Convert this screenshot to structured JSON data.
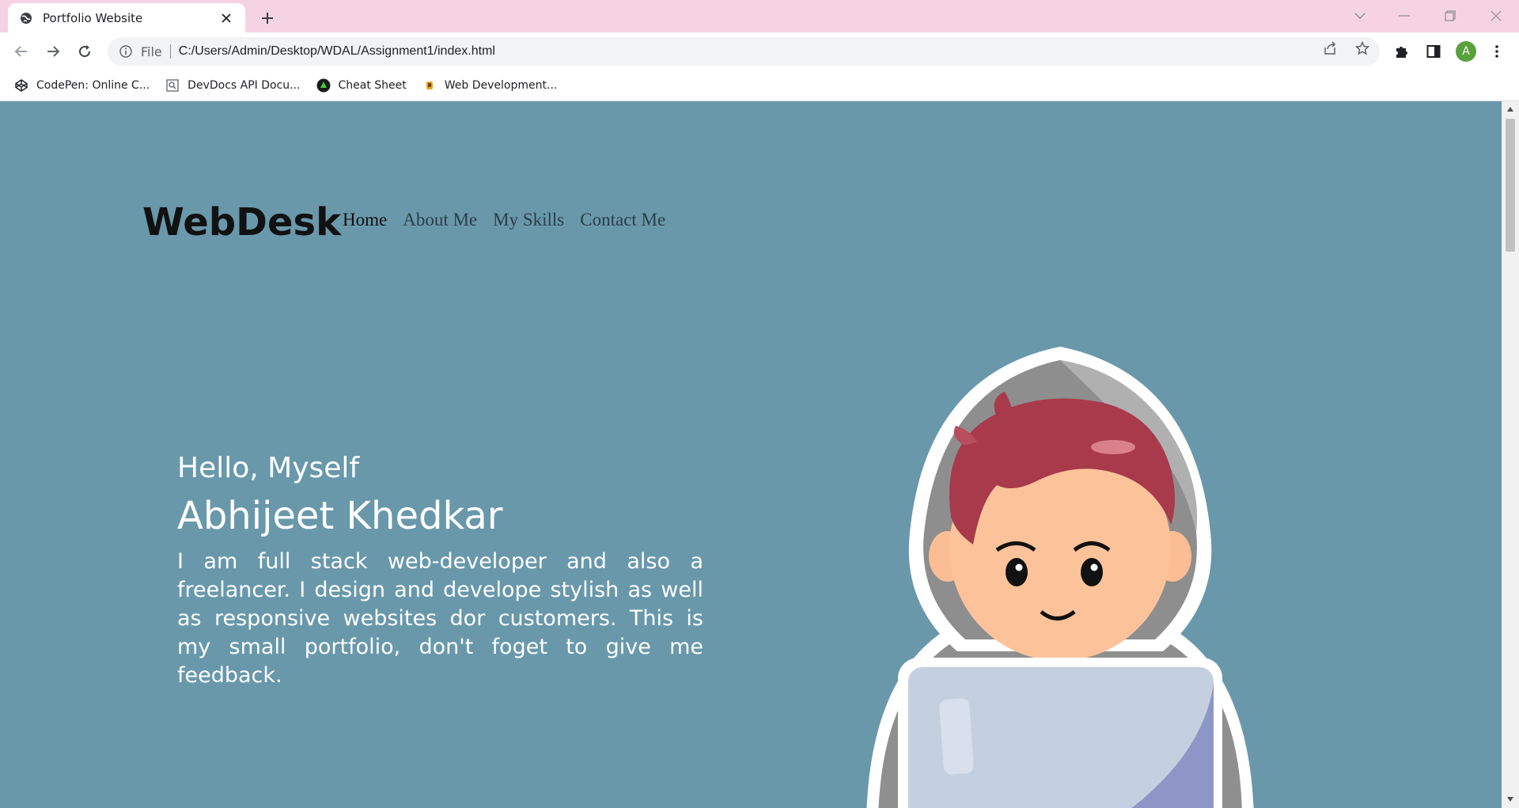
{
  "browser": {
    "tab_title": "Portfolio Website",
    "address_scheme": "File",
    "address_url": "C:/Users/Admin/Desktop/WDAL/Assignment1/index.html",
    "profile_initial": "A",
    "bookmarks": [
      {
        "label": "CodePen: Online C...",
        "icon": "codepen-icon"
      },
      {
        "label": "DevDocs API Docu...",
        "icon": "devdocs-icon"
      },
      {
        "label": "Cheat Sheet",
        "icon": "cheatsheet-icon"
      },
      {
        "label": "Web Development...",
        "icon": "webdev-icon"
      }
    ]
  },
  "page": {
    "logo": "WebDesk",
    "nav": [
      {
        "label": "Home",
        "active": true
      },
      {
        "label": "About Me",
        "active": false
      },
      {
        "label": "My Skills",
        "active": false
      },
      {
        "label": "Contact Me",
        "active": false
      }
    ],
    "hero": {
      "greeting": "Hello, Myself",
      "name": "Abhijeet Khedkar",
      "description": "I am full stack web-developer and also a freelancer. I design and develope stylish as well as responsive websites dor customers. This is my small portfolio, don't foget to give me feedback."
    }
  },
  "colors": {
    "page_background": "#6998ab",
    "tab_strip": "#f6d3e3",
    "logo_text": "#111111",
    "hero_text": "#ffffff"
  }
}
